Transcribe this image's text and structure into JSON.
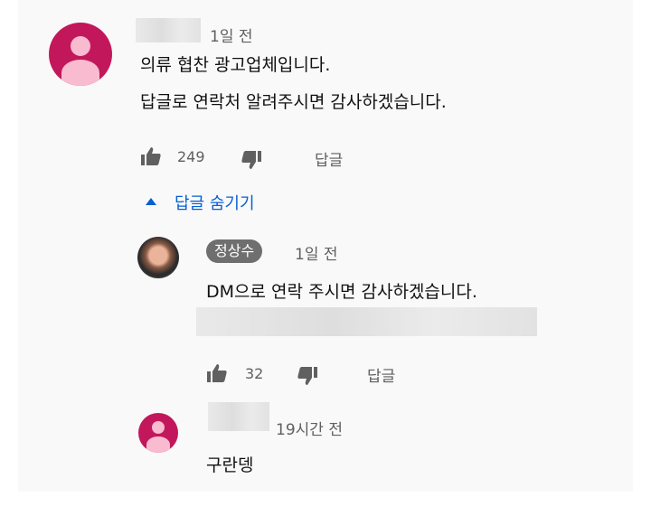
{
  "comment": {
    "time": "1일 전",
    "lines": [
      "의류 협찬 광고업체입니다.",
      "답글로 연락처 알려주시면 감사하겠습니다."
    ],
    "likes": "249",
    "reply_label": "답글",
    "like_icon": "thumb-up-icon",
    "dislike_icon": "thumb-down-icon"
  },
  "replies_toggle": {
    "label": "답글 숨기기",
    "icon": "caret-up-icon"
  },
  "replies": [
    {
      "author": "정상수",
      "time": "1일 전",
      "text": "DM으로 연락 주시면 감사하겠습니다.",
      "likes": "32",
      "reply_label": "답글"
    },
    {
      "time": "19시간 전",
      "text": "구란뎅"
    }
  ],
  "colors": {
    "avatar": "#c2185b",
    "avatar_figure": "#f8bbd0",
    "link": "#065fd4",
    "badge": "#6f6f6f"
  }
}
